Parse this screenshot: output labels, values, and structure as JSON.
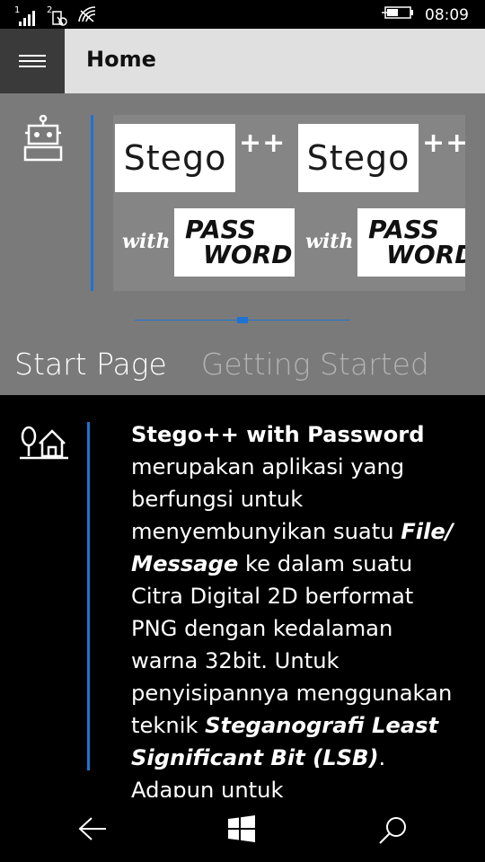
{
  "status_bar": {
    "sim1": "1",
    "sim2": "2",
    "time": "08:09",
    "icons": [
      "signal-icon",
      "sim2-signal-icon",
      "wifi-icon",
      "battery-charging-icon"
    ]
  },
  "app_bar": {
    "title": "Home",
    "menu_icon": "hamburger-icon"
  },
  "hero": {
    "icon": "robot-icon",
    "banner": {
      "tiles": [
        {
          "stego": "Stego",
          "plus": "++",
          "with": "with",
          "pass": "PASS",
          "word": "WORD"
        },
        {
          "stego": "Stego",
          "plus": "++",
          "with": "with",
          "pass": "PASS",
          "word": "WORD"
        }
      ]
    },
    "flipview_position": 0.5
  },
  "pivot": {
    "tabs": [
      {
        "label": "Start Page",
        "active": true
      },
      {
        "label": "Getting Started",
        "active": false
      }
    ]
  },
  "content": {
    "icon": "tree-home-icon",
    "segments": [
      {
        "text": "Stego++ with Password",
        "style": "bold"
      },
      {
        "text": " merupakan aplikasi yang berfungsi untuk menyembunyikan suatu ",
        "style": "normal"
      },
      {
        "text": "File/ Message",
        "style": "bold-italic"
      },
      {
        "text": " ke dalam suatu Citra Digital 2D berformat PNG dengan kedalaman warna 32bit. Untuk penyisipannya menggunakan teknik ",
        "style": "normal"
      },
      {
        "text": "Steganografi Least Significant Bit (LSB)",
        "style": "bold-italic"
      },
      {
        "text": ". Adapun untuk",
        "style": "normal"
      }
    ]
  },
  "nav_bar": {
    "buttons": [
      "back-arrow-icon",
      "windows-start-icon",
      "search-icon"
    ]
  },
  "colors": {
    "accent": "#1e73d2",
    "app_bar_bg": "#e0e0e0",
    "hero_bg": "#7a7a7a",
    "content_bg": "#000000"
  }
}
